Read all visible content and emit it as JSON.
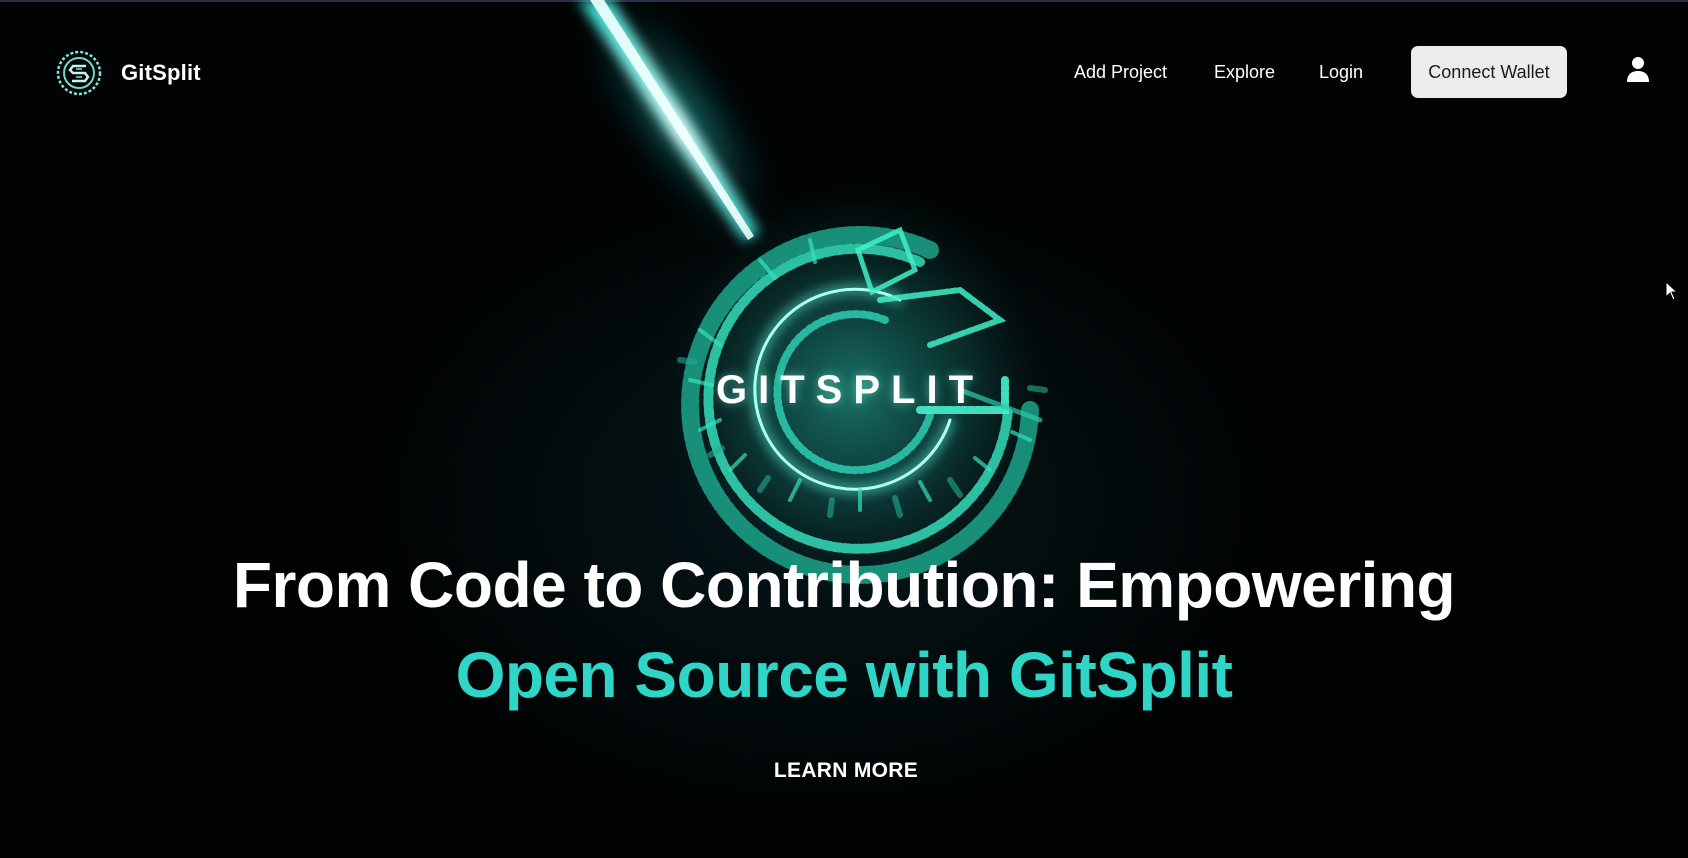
{
  "nav": {
    "brand_name": "GitSplit",
    "add_project": "Add Project",
    "explore": "Explore",
    "login": "Login",
    "connect_wallet": "Connect Wallet"
  },
  "hero": {
    "art_wordmark": "GITSPLIT",
    "headline_line1": "From Code to Contribution: Empowering",
    "headline_line2": "Open Source with GitSplit",
    "cta": "LEARN MORE"
  },
  "colors": {
    "accent": "#2fd6c8",
    "background": "#010304",
    "button_bg": "#ececec",
    "glow": "#39f5d8"
  },
  "icons": {
    "logo": "gitsplit-logo-icon",
    "user": "user-icon",
    "cursor": "mouse-pointer-icon"
  }
}
